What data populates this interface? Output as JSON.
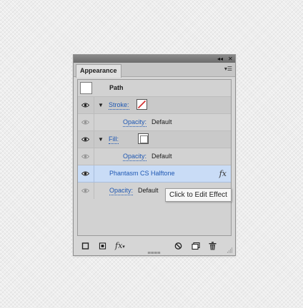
{
  "panel": {
    "tab_label": "Appearance",
    "collapse_glyph": "◂◂",
    "close_glyph": "✕",
    "menu_glyph": "▾☰"
  },
  "rows": {
    "path": {
      "label": "Path"
    },
    "stroke": {
      "label": "Stroke:",
      "swatch": "none"
    },
    "stroke_opacity": {
      "label": "Opacity:",
      "value": "Default"
    },
    "fill": {
      "label": "Fill:",
      "swatch": "white"
    },
    "fill_opacity": {
      "label": "Opacity:",
      "value": "Default"
    },
    "effect": {
      "label": "Phantasm CS Halftone",
      "fx": "fx"
    },
    "opacity": {
      "label": "Opacity:",
      "value": "Default"
    }
  },
  "toolbar": {
    "fx_label": "fx"
  },
  "tooltip": {
    "text": "Click to Edit Effect"
  },
  "colors": {
    "link_blue": "#1f58b3",
    "selected_row": "#c9dcf6",
    "stroke_none_red": "#d22b2b"
  },
  "icons": [
    "eye-icon",
    "disclosure-triangle-icon",
    "fx-icon",
    "new-stroke-icon",
    "new-fill-icon",
    "clear-appearance-icon",
    "duplicate-item-icon",
    "trash-icon",
    "resize-grip-icon"
  ]
}
